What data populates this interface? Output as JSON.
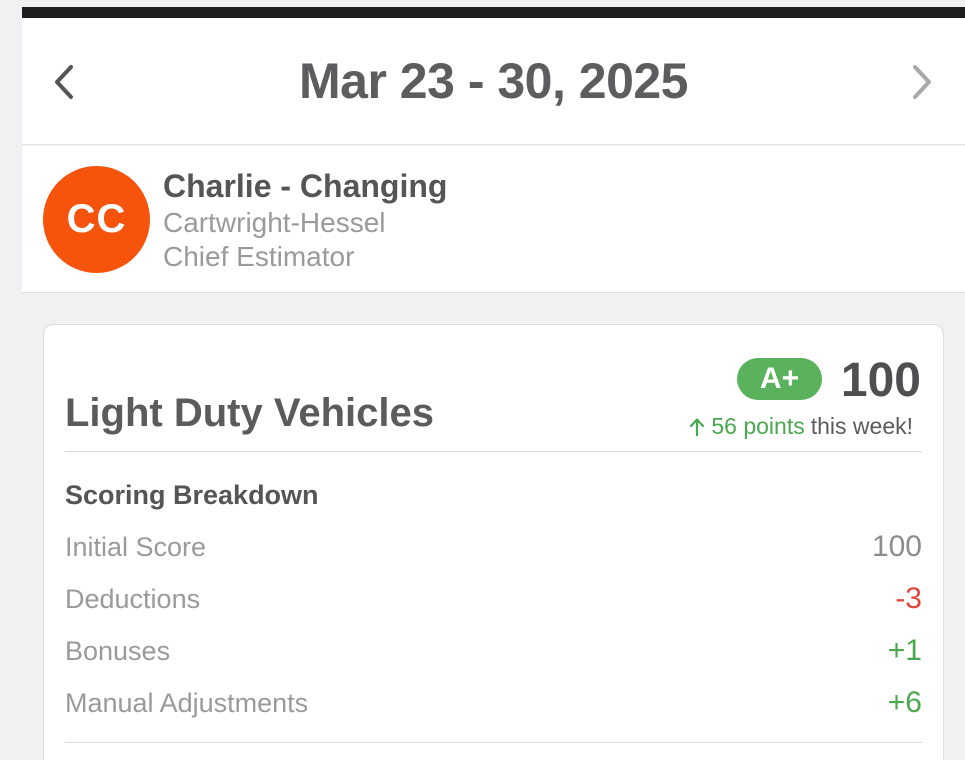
{
  "header": {
    "date_range": "Mar 23 - 30, 2025",
    "prev_icon": "chevron-left-icon",
    "next_icon": "chevron-right-icon"
  },
  "profile": {
    "initials": "CC",
    "name": "Charlie - Changing",
    "company": "Cartwright-Hessel",
    "role": "Chief Estimator",
    "avatar_color": "#f6540d"
  },
  "card": {
    "title": "Light Duty Vehicles",
    "grade": "A+",
    "score": "100",
    "change_points": "56 points",
    "change_suffix": "this week!",
    "change_icon": "arrow-up-icon",
    "breakdown_title": "Scoring Breakdown",
    "rows": [
      {
        "label": "Initial Score",
        "value": "100",
        "tone": "neutral"
      },
      {
        "label": "Deductions",
        "value": "-3",
        "tone": "negative"
      },
      {
        "label": "Bonuses",
        "value": "+1",
        "tone": "positive"
      },
      {
        "label": "Manual Adjustments",
        "value": "+6",
        "tone": "positive"
      }
    ]
  },
  "colors": {
    "grade_badge": "#5ab35c",
    "positive": "#4aa84e",
    "negative": "#e0463e"
  }
}
